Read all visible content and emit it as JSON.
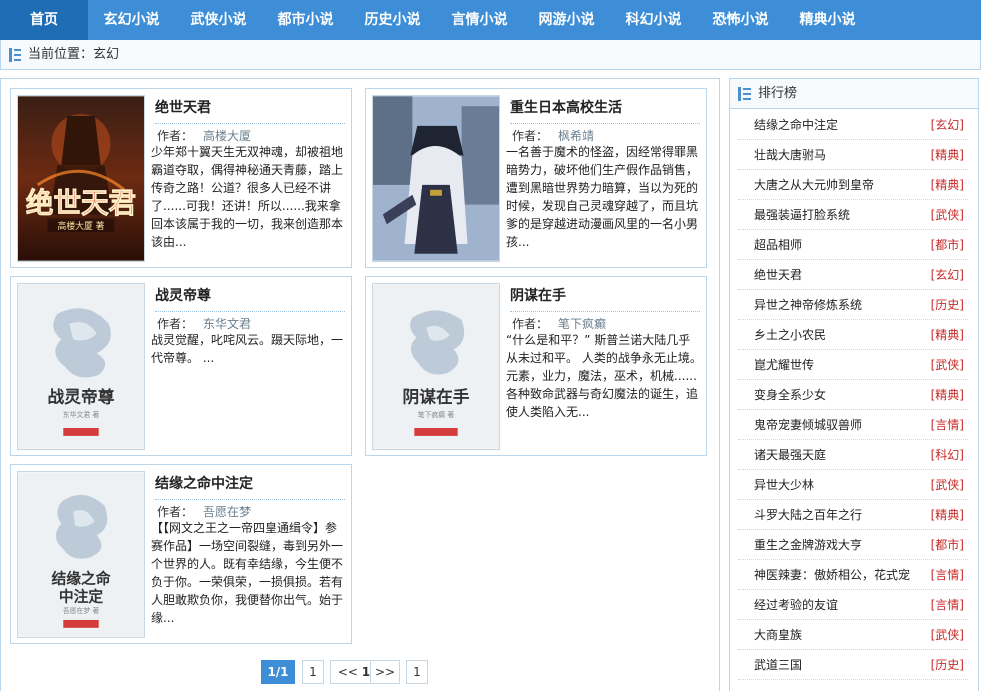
{
  "nav": {
    "items": [
      "首页",
      "玄幻小说",
      "武侠小说",
      "都市小说",
      "历史小说",
      "言情小说",
      "网游小说",
      "科幻小说",
      "恐怖小说",
      "精典小说"
    ]
  },
  "breadcrumb": {
    "text": "当前位置：玄幻"
  },
  "books": [
    {
      "title": "绝世天君",
      "author_label": "作者：",
      "author": "高楼大厦",
      "desc": "少年郑十翼天生无双神魂，却被祖地霸道夺取，偶得神秘通天青藤，踏上传奇之路！公道？很多人已经不讲了......可我！还讲！所以......我来拿回本该属于我的一切，我来创造那本该由...",
      "cover_title": "绝世天君",
      "cover_author": "高楼大厦 著"
    },
    {
      "title": "重生日本高校生活",
      "author_label": "作者：",
      "author": "枫希靖",
      "desc": "一名善于魔术的怪盗，因经常得罪黑暗势力，破坏他们生产假作品销售，遭到黑暗世界势力暗算，当以为死的时候，发现自己灵魂穿越了，而且坑爹的是穿越进动漫画风里的一名小男孩...",
      "cover_title": "",
      "cover_author": ""
    },
    {
      "title": "战灵帝尊",
      "author_label": "作者：",
      "author": "东华文君",
      "desc": "战灵觉醒，叱咤风云。蹑天际地，一代帝尊。 ...",
      "cover_title": "战灵帝尊",
      "cover_author": "东华文君 著"
    },
    {
      "title": "阴谋在手",
      "author_label": "作者：",
      "author": "笔下疯癫",
      "desc": "“什么是和平？” 斯普兰诺大陆几乎从未过和平。 人类的战争永无止境。 元素，业力，魔法，巫术，机械...... 各种致命武器与奇幻魔法的诞生，追使人类陷入无...",
      "cover_title": "阴谋在手",
      "cover_author": "笔下疯癫 著"
    },
    {
      "title": "结缘之命中注定",
      "author_label": "作者：",
      "author": "吾愿在梦",
      "desc": "【【网文之王之一帝四皇通缉令】参赛作品】一场空间裂缝，毒到另外一个世界的人。既有幸结缘，今生便不负于你。一荣俱荣，一损俱损。若有人胆敢欺负你，我便替你出气。始于缘...",
      "cover_title": "结缘之命中注定",
      "cover_author": "吾愿在梦 著"
    }
  ],
  "pagination": {
    "current": "1/1",
    "first": "1",
    "prev": "<<",
    "page": "1",
    "next": ">>",
    "last": "1"
  },
  "sidebar": {
    "title": "排行榜",
    "items": [
      {
        "name": "结缘之命中注定",
        "cat": "[玄幻]"
      },
      {
        "name": "壮哉大唐驸马",
        "cat": "[精典]"
      },
      {
        "name": "大唐之从大元帅到皇帝",
        "cat": "[精典]"
      },
      {
        "name": "最强装逼打脸系统",
        "cat": "[武侠]"
      },
      {
        "name": "超品相师",
        "cat": "[都市]"
      },
      {
        "name": "绝世天君",
        "cat": "[玄幻]"
      },
      {
        "name": "异世之神帝修炼系统",
        "cat": "[历史]"
      },
      {
        "name": "乡土之小农民",
        "cat": "[精典]"
      },
      {
        "name": "崑尤耀世传",
        "cat": "[武侠]"
      },
      {
        "name": "变身全系少女",
        "cat": "[精典]"
      },
      {
        "name": "鬼帝宠妻倾城驭兽师",
        "cat": "[言情]"
      },
      {
        "name": "诸天最强天庭",
        "cat": "[科幻]"
      },
      {
        "name": "异世大少林",
        "cat": "[武侠]"
      },
      {
        "name": "斗罗大陆之百年之行",
        "cat": "[精典]"
      },
      {
        "name": "重生之金牌游戏大亨",
        "cat": "[都市]"
      },
      {
        "name": "神医辣妻：傲娇相公，花式宠",
        "cat": "[言情]"
      },
      {
        "name": "经过考验的友谊",
        "cat": "[言情]"
      },
      {
        "name": "大商皇族",
        "cat": "[武侠]"
      },
      {
        "name": "武道三国",
        "cat": "[历史]"
      }
    ]
  },
  "colors": {
    "accent": "#3d8ed6",
    "nav_active": "#1f6db5",
    "border": "#b9d6ec",
    "category": "#c92a2a"
  }
}
